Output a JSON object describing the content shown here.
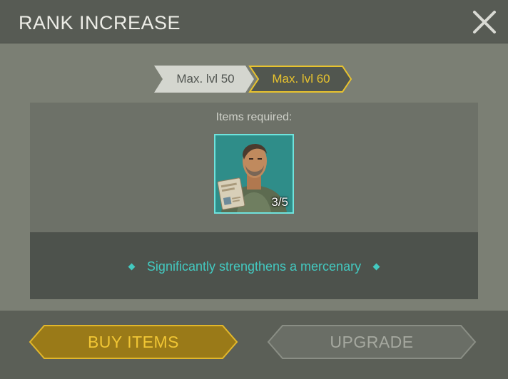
{
  "header": {
    "title": "RANK INCREASE",
    "close_icon": "close-icon"
  },
  "levels": {
    "current_label": "Max. lvl 50",
    "next_label": "Max. lvl 60"
  },
  "requirements": {
    "label": "Items required:",
    "item": {
      "icon": "mercenary-portrait-with-dossier",
      "count_text": "3/5",
      "owned": 3,
      "required": 5
    }
  },
  "description": {
    "text": "Significantly strengthens a mercenary"
  },
  "buttons": {
    "buy_label": "BUY ITEMS",
    "upgrade_label": "UPGRADE"
  },
  "colors": {
    "accent_teal": "#43c9c0",
    "gold": "#e8c32e",
    "buy_button": "#9a7a18",
    "upgrade_button_disabled": "#6a6e66"
  }
}
